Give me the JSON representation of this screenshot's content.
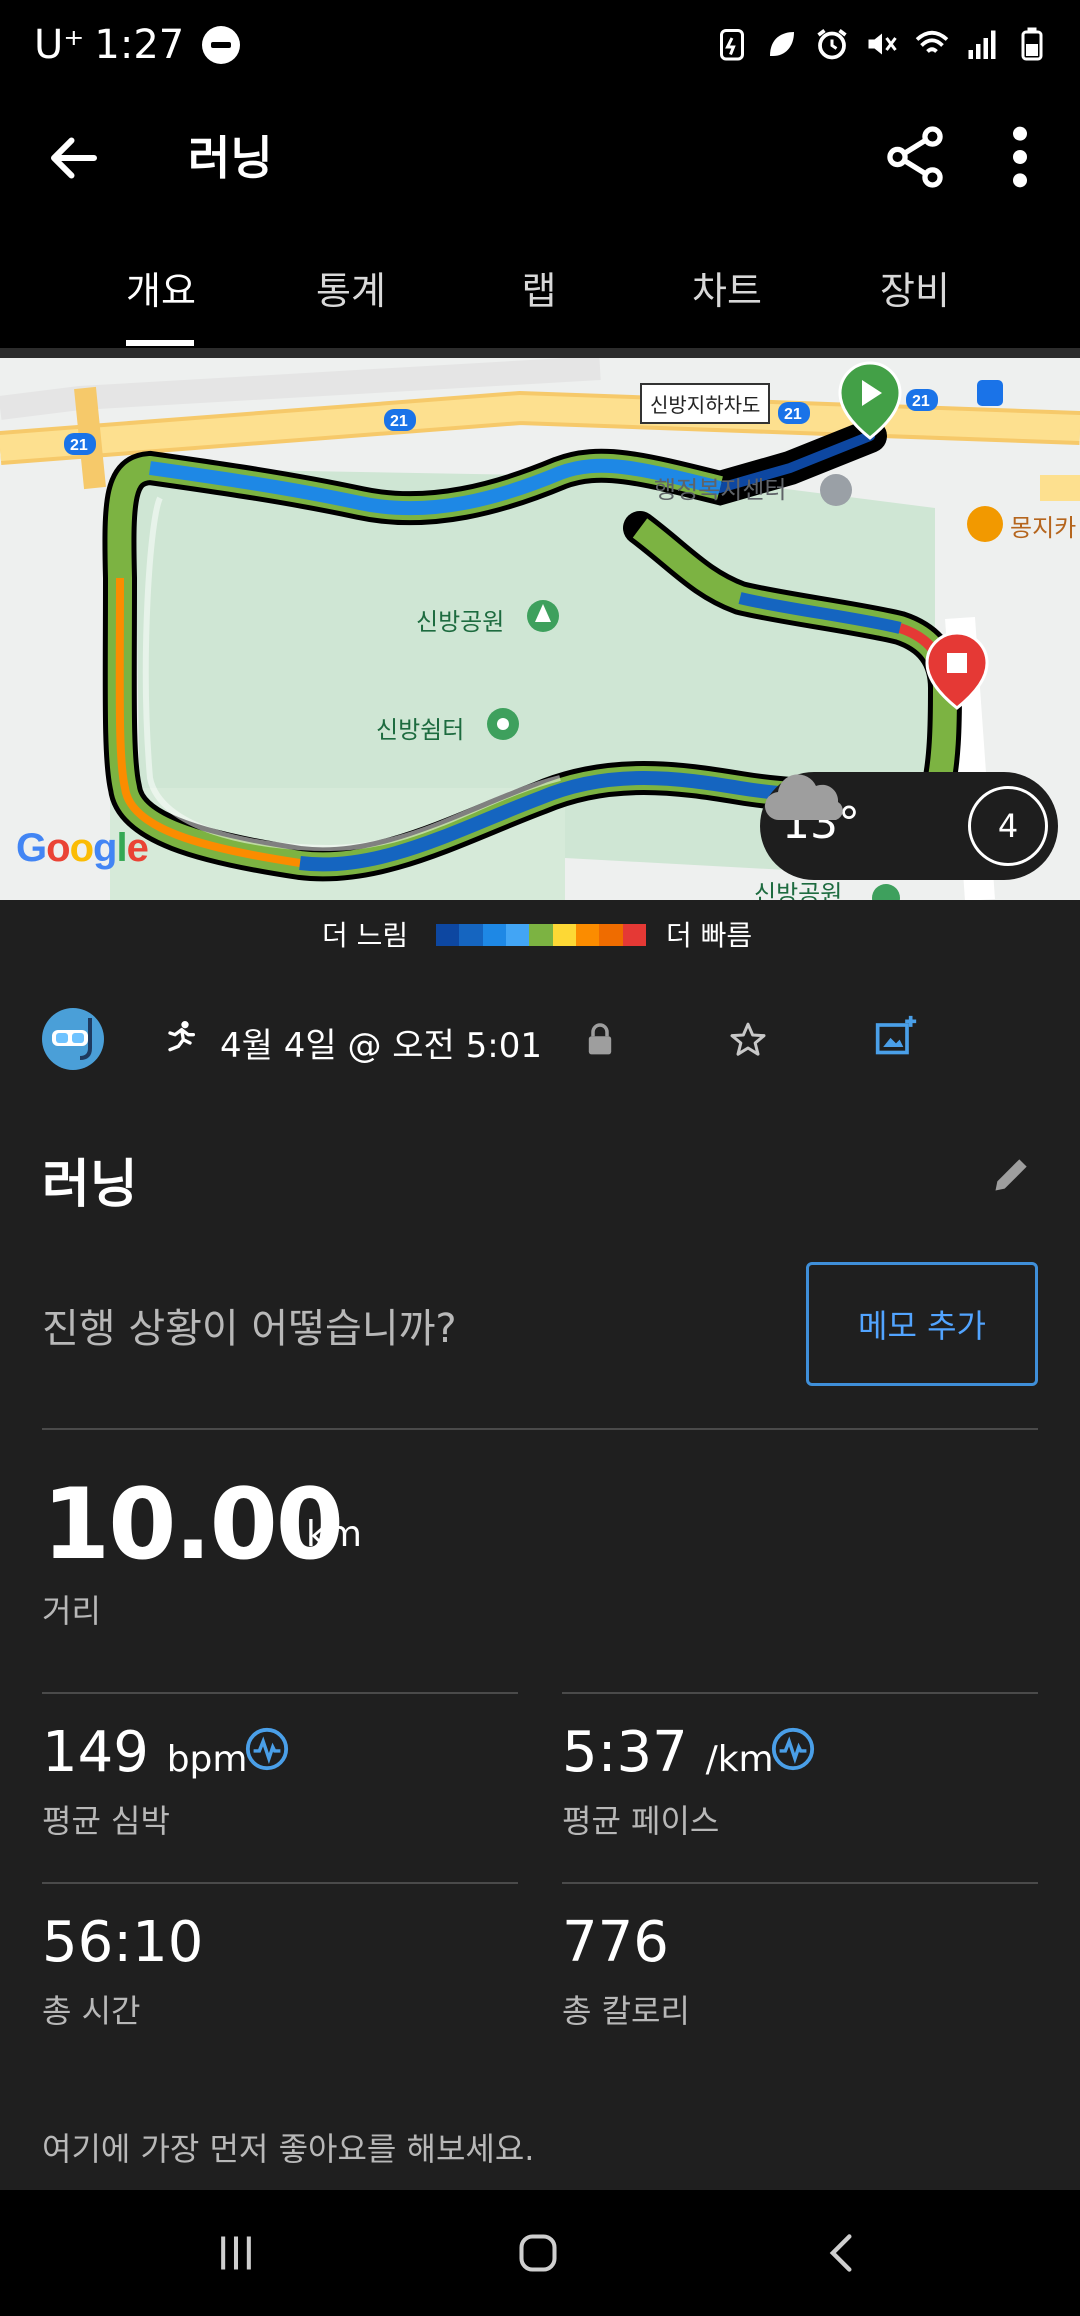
{
  "status_bar": {
    "carrier": "U⁺",
    "time": "1:27",
    "icons": [
      "dnd-icon",
      "battery-saver-icon",
      "leaf-icon",
      "alarm-icon",
      "mute-icon",
      "wifi-icon",
      "signal-icon",
      "battery-icon"
    ]
  },
  "app_bar": {
    "title": "러닝",
    "icons": [
      "back-arrow-icon",
      "share-icon",
      "more-vert-icon"
    ]
  },
  "tabs": [
    {
      "label": "개요",
      "active": true
    },
    {
      "label": "통계",
      "active": false
    },
    {
      "label": "랩",
      "active": false
    },
    {
      "label": "차트",
      "active": false
    },
    {
      "label": "장비",
      "active": false
    }
  ],
  "map": {
    "labels": {
      "park": "신방공원",
      "shelter": "신방쉼터",
      "welfare": "행정복지센터",
      "cafe": "몽지카",
      "tunnel": "신방지하차도",
      "park_bottom": "신방공원",
      "road": "21"
    },
    "weather": {
      "temp": "13°",
      "wind": "4",
      "icon": "cloud-icon"
    },
    "attribution": "Google"
  },
  "pace_legend": {
    "slow": "더 느림",
    "fast": "더 빠름",
    "colors": [
      "#0d47a1",
      "#1565c0",
      "#1e88e5",
      "#42a5f5",
      "#7cb342",
      "#fdd835",
      "#fb8c00",
      "#ef6c00",
      "#e53935"
    ]
  },
  "activity": {
    "date_time": "4월 4일 @ 오전 5:01",
    "title": "러닝",
    "question": "진행 상황이 어떻습니까?",
    "memo_button": "메모 추가"
  },
  "stats": {
    "distance": {
      "value": "10.00",
      "unit": "km",
      "label": "거리"
    },
    "heart_rate": {
      "value": "149",
      "unit": "bpm",
      "label": "평균 심박"
    },
    "pace": {
      "value": "5:37",
      "unit": "/km",
      "label": "평균 페이스"
    },
    "time": {
      "value": "56:10",
      "label": "총 시간"
    },
    "calories": {
      "value": "776",
      "label": "총 칼로리"
    }
  },
  "footer": {
    "like_text": "여기에 가장 먼저 좋아요를 해보세요."
  },
  "nav_bar": {
    "icons": [
      "recent-apps-icon",
      "home-icon",
      "back-icon"
    ]
  },
  "colors": {
    "accent": "#3f8fd9",
    "background": "#1f1f1f",
    "bar_background": "#000000"
  }
}
